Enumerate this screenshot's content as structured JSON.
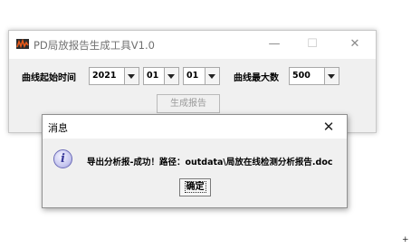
{
  "main_window": {
    "title": "PD局放报告生成工具V1.0",
    "controls": {
      "minimize": "—",
      "maximize": "☐",
      "close": "✕"
    },
    "form": {
      "start_time_label": "曲线起始时间",
      "year": "2021",
      "month": "01",
      "day": "01",
      "max_count_label": "曲线最大数",
      "max_count": "500"
    },
    "generate_button": "生成报告"
  },
  "dialog": {
    "title": "消息",
    "close": "✕",
    "icon": "i",
    "message": "导出分析报-成功！路径：outdata\\局放在线检测分析报告.doc",
    "ok_button": "确定"
  },
  "corner_mark": "+"
}
